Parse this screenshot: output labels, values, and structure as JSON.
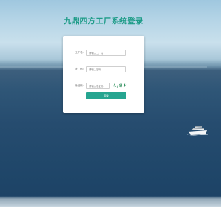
{
  "page": {
    "title": "九鼎四方工厂系统登录"
  },
  "form": {
    "factory": {
      "label": "工厂名:",
      "placeholder": "请输入工厂名"
    },
    "password": {
      "label": "密　码:",
      "placeholder": "请输入密码"
    },
    "captcha": {
      "label": "验证码:",
      "placeholder": "请输入验证码",
      "image_text": [
        "4",
        "r",
        "8",
        "y"
      ]
    },
    "submit_label": "登录"
  },
  "colors": {
    "title": "#1e9c88",
    "button": "#26a590",
    "captcha_text": "#2e8f5c"
  },
  "icons": [
    "yacht-image"
  ]
}
